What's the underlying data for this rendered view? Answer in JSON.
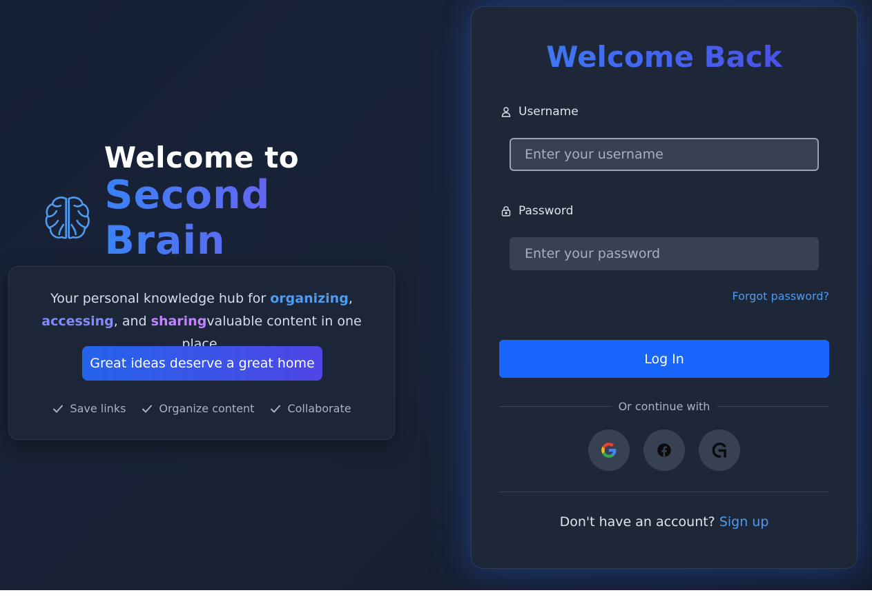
{
  "hero": {
    "title": "Welcome to",
    "brand_name": "Second Brain",
    "intro": {
      "text_before": "Your personal knowledge hub for ",
      "word_organizing": "organizing",
      "comma": ",",
      "word_accessing": "accessing",
      "and_text": ", and ",
      "word_sharing": "sharing",
      "text_after": "valuable content in one place."
    },
    "cta_label": "Great ideas deserve a great home",
    "features": [
      "Save links",
      "Organize content",
      "Collaborate"
    ]
  },
  "login": {
    "title": "Welcome Back",
    "username_label": "Username",
    "username_placeholder": "Enter your username",
    "password_label": "Password",
    "password_placeholder": "Enter your password",
    "forgot_label": "Forgot password?",
    "login_button": "Log In",
    "divider_text": "Or continue with",
    "socials": [
      "google-icon",
      "facebook-icon",
      "github-icon"
    ],
    "signup_prompt": "Don't have an account?",
    "signup_link": "Sign up"
  },
  "colors": {
    "accent_blue": "#1966ff",
    "link_blue": "#4f9bf0",
    "purple": "#a855f7",
    "background": "#1a2336"
  }
}
